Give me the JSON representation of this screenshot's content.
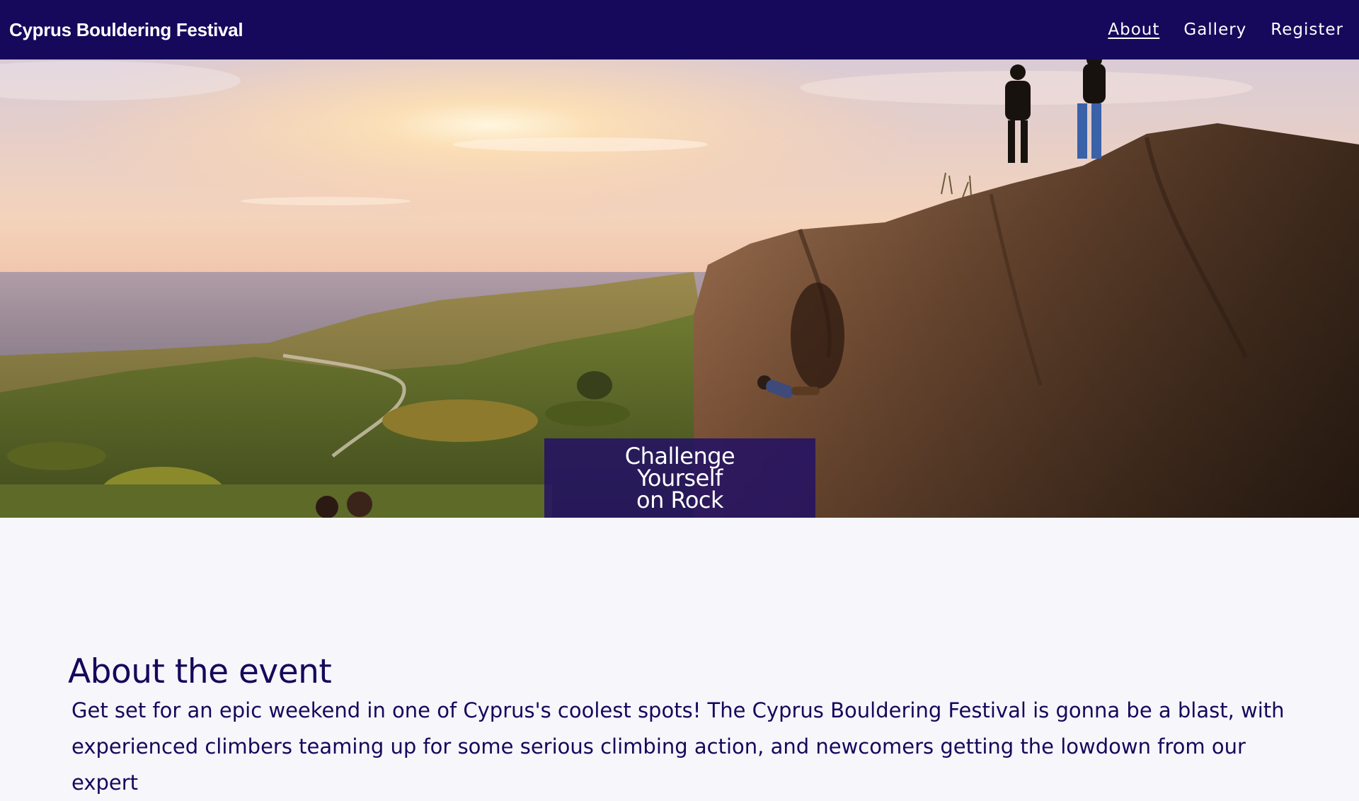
{
  "nav": {
    "brand": "Cyprus Bouldering Festival",
    "links": [
      {
        "label": "About",
        "active": true
      },
      {
        "label": "Gallery",
        "active": false
      },
      {
        "label": "Register",
        "active": false
      }
    ]
  },
  "hero": {
    "image_alt": "Climbers on a boulder at sunset overlooking hills and the sea",
    "cta_lines": [
      "Challenge",
      "Yourself",
      "on Rock"
    ]
  },
  "about": {
    "title": "About the event",
    "text": "Get set for an epic weekend in one of Cyprus's coolest spots! The Cyprus Bouldering Festival is gonna be a blast, with experienced climbers teaming up for some serious climbing action, and newcomers getting the lowdown from our expert"
  },
  "colors": {
    "nav_bg": "#16085b",
    "text_primary": "#16085b",
    "page_bg": "#f6f6fb",
    "cta_bg": "#221064"
  }
}
